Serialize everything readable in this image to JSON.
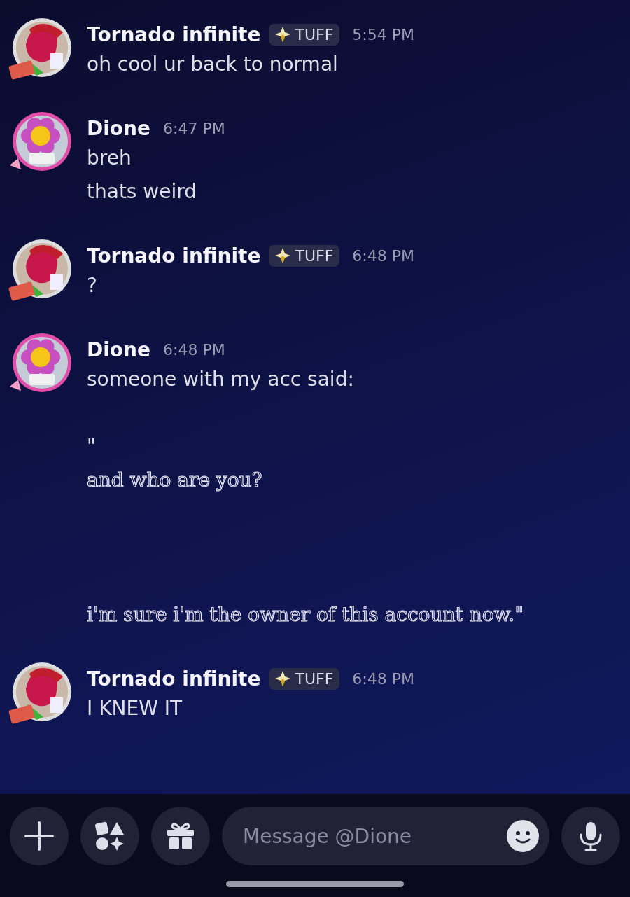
{
  "messages": [
    {
      "author": "Tornado infinite",
      "kind": "tornado",
      "badge": "TUFF",
      "time": "5:54 PM",
      "lines": [
        {
          "kind": "text",
          "text": "oh cool ur back to normal"
        }
      ]
    },
    {
      "author": "Dione",
      "kind": "flower",
      "time": "6:47 PM",
      "lines": [
        {
          "kind": "text",
          "text": "breh"
        },
        {
          "kind": "text",
          "text": "thats weird"
        }
      ]
    },
    {
      "author": "Tornado infinite",
      "kind": "tornado",
      "badge": "TUFF",
      "time": "6:48 PM",
      "lines": [
        {
          "kind": "text",
          "text": "?"
        }
      ]
    },
    {
      "author": "Dione",
      "kind": "flower",
      "time": "6:48 PM",
      "lines": [
        {
          "kind": "text",
          "text": "someone with my acc said:"
        },
        {
          "kind": "blank"
        },
        {
          "kind": "text",
          "text": "\""
        },
        {
          "kind": "outline",
          "text": "and who are you?"
        },
        {
          "kind": "blank"
        },
        {
          "kind": "blank"
        },
        {
          "kind": "blank"
        },
        {
          "kind": "outline",
          "text": "i'm sure i'm the owner of this account now.\""
        }
      ]
    },
    {
      "author": "Tornado infinite",
      "kind": "tornado",
      "badge": "TUFF",
      "time": "6:48 PM",
      "lines": [
        {
          "kind": "text",
          "text": "I KNEW IT"
        }
      ]
    }
  ],
  "composer": {
    "placeholder": "Message @Dione"
  }
}
